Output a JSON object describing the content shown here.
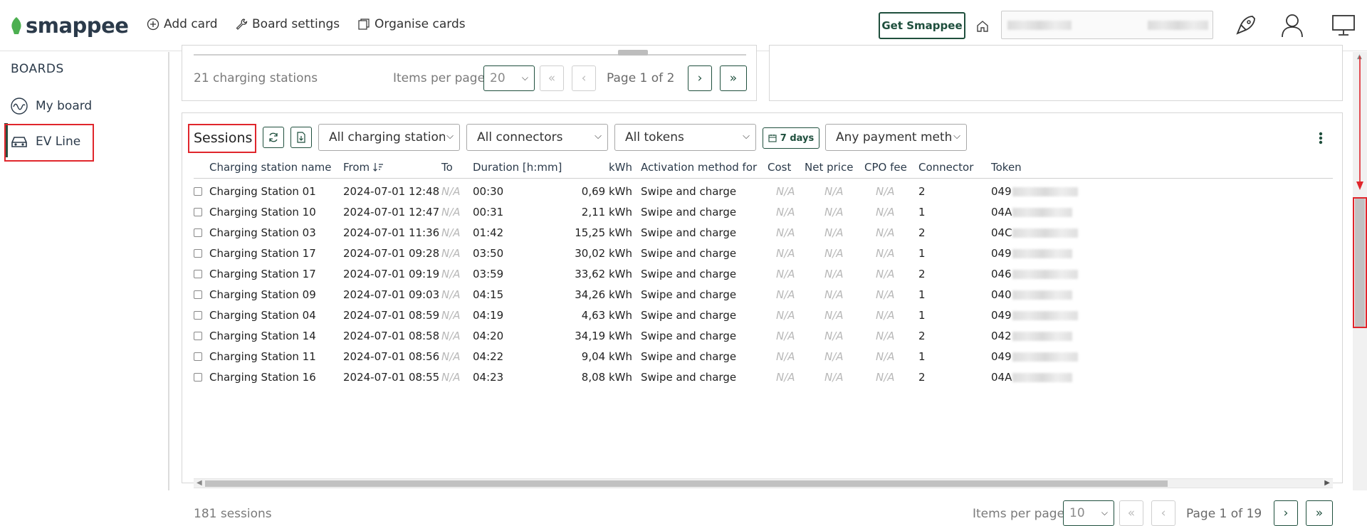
{
  "topbar": {
    "logo_text": "smappee",
    "add_card": "Add card",
    "board_settings": "Board settings",
    "organise_cards": "Organise cards",
    "get_smappee": "Get Smappee"
  },
  "sidebar": {
    "title": "BOARDS",
    "items": [
      {
        "label": "My board",
        "icon": "wave-icon"
      },
      {
        "label": "EV Line",
        "icon": "car-icon"
      }
    ]
  },
  "stations_card": {
    "count_text": "21 charging stations",
    "items_per_page_label": "Items per page",
    "items_per_page": "20",
    "page_text": "Page 1 of 2"
  },
  "sessions_card": {
    "title": "Sessions",
    "filters": {
      "station": "All charging station",
      "connectors": "All connectors",
      "tokens": "All tokens",
      "days": "7 days",
      "payment": "Any payment metho"
    },
    "columns": [
      "Charging station name",
      "From",
      "To",
      "Duration [h:mm]",
      "kWh",
      "Activation method for",
      "Cost",
      "Net price",
      "CPO fee",
      "Connector",
      "Token"
    ],
    "rows": [
      {
        "station": "Charging Station 01",
        "from": "2024-07-01 12:48",
        "to": "N/A",
        "duration": "00:30",
        "kwh": "0,69 kWh",
        "activation": "Swipe and charge",
        "cost": "N/A",
        "net": "N/A",
        "cpo": "N/A",
        "connector": "2",
        "token": "049"
      },
      {
        "station": "Charging Station 10",
        "from": "2024-07-01 12:47",
        "to": "N/A",
        "duration": "00:31",
        "kwh": "2,11 kWh",
        "activation": "Swipe and charge",
        "cost": "N/A",
        "net": "N/A",
        "cpo": "N/A",
        "connector": "1",
        "token": "04A"
      },
      {
        "station": "Charging Station 03",
        "from": "2024-07-01 11:36",
        "to": "N/A",
        "duration": "01:42",
        "kwh": "15,25 kWh",
        "activation": "Swipe and charge",
        "cost": "N/A",
        "net": "N/A",
        "cpo": "N/A",
        "connector": "2",
        "token": "04C"
      },
      {
        "station": "Charging Station 17",
        "from": "2024-07-01 09:28",
        "to": "N/A",
        "duration": "03:50",
        "kwh": "30,02 kWh",
        "activation": "Swipe and charge",
        "cost": "N/A",
        "net": "N/A",
        "cpo": "N/A",
        "connector": "1",
        "token": "049"
      },
      {
        "station": "Charging Station 17",
        "from": "2024-07-01 09:19",
        "to": "N/A",
        "duration": "03:59",
        "kwh": "33,62 kWh",
        "activation": "Swipe and charge",
        "cost": "N/A",
        "net": "N/A",
        "cpo": "N/A",
        "connector": "2",
        "token": "046"
      },
      {
        "station": "Charging Station 09",
        "from": "2024-07-01 09:03",
        "to": "N/A",
        "duration": "04:15",
        "kwh": "34,26 kWh",
        "activation": "Swipe and charge",
        "cost": "N/A",
        "net": "N/A",
        "cpo": "N/A",
        "connector": "1",
        "token": "040"
      },
      {
        "station": "Charging Station 04",
        "from": "2024-07-01 08:59",
        "to": "N/A",
        "duration": "04:19",
        "kwh": "4,63 kWh",
        "activation": "Swipe and charge",
        "cost": "N/A",
        "net": "N/A",
        "cpo": "N/A",
        "connector": "1",
        "token": "049"
      },
      {
        "station": "Charging Station 14",
        "from": "2024-07-01 08:58",
        "to": "N/A",
        "duration": "04:20",
        "kwh": "34,19 kWh",
        "activation": "Swipe and charge",
        "cost": "N/A",
        "net": "N/A",
        "cpo": "N/A",
        "connector": "2",
        "token": "042"
      },
      {
        "station": "Charging Station 11",
        "from": "2024-07-01 08:56",
        "to": "N/A",
        "duration": "04:22",
        "kwh": "9,04 kWh",
        "activation": "Swipe and charge",
        "cost": "N/A",
        "net": "N/A",
        "cpo": "N/A",
        "connector": "1",
        "token": "049"
      },
      {
        "station": "Charging Station 16",
        "from": "2024-07-01 08:55",
        "to": "N/A",
        "duration": "04:23",
        "kwh": "8,08 kWh",
        "activation": "Swipe and charge",
        "cost": "N/A",
        "net": "N/A",
        "cpo": "N/A",
        "connector": "2",
        "token": "04A"
      }
    ],
    "count_text": "181 sessions",
    "items_per_page_label": "Items per page",
    "items_per_page": "10",
    "page_text": "Page 1 of 19"
  },
  "colors": {
    "brand_green": "#1f4f3d",
    "logo_leaf": "#4caf50",
    "highlight_red": "#e0262c"
  }
}
